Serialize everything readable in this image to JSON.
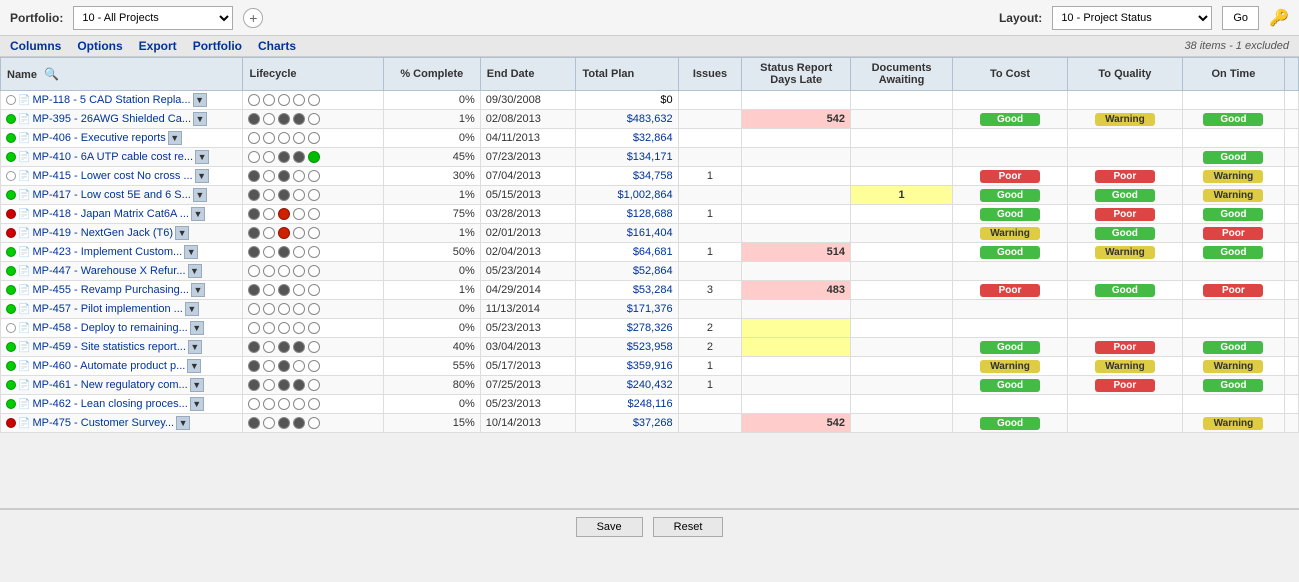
{
  "topbar": {
    "portfolio_label": "Portfolio:",
    "portfolio_value": "10 - All Projects",
    "add_btn_title": "+",
    "layout_label": "Layout:",
    "layout_value": "10 - Project Status",
    "go_label": "Go"
  },
  "menubar": {
    "items": [
      "Columns",
      "Options",
      "Export",
      "Portfolio",
      "Charts"
    ],
    "count_text": "38 items - 1 excluded"
  },
  "table": {
    "headers": [
      "Name",
      "Lifecycle",
      "% Complete",
      "End Date",
      "Total Plan",
      "Issues",
      "Status Report Days Late",
      "Documents Awaiting",
      "To Cost",
      "To Quality",
      "On Time"
    ],
    "rows": [
      {
        "dot": "empty",
        "file": true,
        "name": "MP-118 - 5 CAD Station Repla...",
        "has_dd": true,
        "lifecycle": [
          0,
          0,
          0,
          0,
          0
        ],
        "pct": "0%",
        "end": "09/30/2008",
        "total": "$0",
        "total_blue": false,
        "issues": "",
        "days_late": "",
        "days_late_style": "",
        "docs": "",
        "to_cost": "",
        "to_quality": "",
        "on_time": ""
      },
      {
        "dot": "green",
        "file": true,
        "name": "MP-395 - 26AWG Shielded Ca...",
        "has_dd": true,
        "lifecycle": [
          2,
          0,
          2,
          2,
          0
        ],
        "pct": "1%",
        "end": "02/08/2013",
        "total": "$483,632",
        "total_blue": true,
        "issues": "",
        "days_late": "542",
        "days_late_style": "red",
        "docs": "",
        "to_cost": "Good",
        "to_quality": "Warning",
        "on_time": "Good"
      },
      {
        "dot": "green",
        "file": true,
        "name": "MP-406 - Executive reports",
        "has_dd": true,
        "lifecycle": [
          0,
          0,
          0,
          0,
          0
        ],
        "pct": "0%",
        "end": "04/11/2013",
        "total": "$32,864",
        "total_blue": true,
        "issues": "",
        "days_late": "",
        "days_late_style": "",
        "docs": "",
        "to_cost": "",
        "to_quality": "",
        "on_time": ""
      },
      {
        "dot": "green",
        "file": true,
        "name": "MP-410 - 6A UTP cable cost re...",
        "has_dd": true,
        "lifecycle": [
          0,
          0,
          2,
          2,
          1
        ],
        "pct": "45%",
        "end": "07/23/2013",
        "total": "$134,171",
        "total_blue": true,
        "issues": "",
        "days_late": "",
        "days_late_style": "",
        "docs": "",
        "to_cost": "",
        "to_quality": "",
        "on_time": "Good"
      },
      {
        "dot": "empty",
        "file": true,
        "name": "MP-415 - Lower cost No cross ...",
        "has_dd": true,
        "lifecycle": [
          2,
          0,
          2,
          0,
          0
        ],
        "pct": "30%",
        "end": "07/04/2013",
        "total": "$34,758",
        "total_blue": true,
        "issues": "1",
        "days_late": "",
        "days_late_style": "",
        "docs": "",
        "to_cost": "Poor",
        "to_quality": "Poor",
        "on_time": "Warning"
      },
      {
        "dot": "green",
        "file": true,
        "name": "MP-417 - Low cost 5E and 6 S...",
        "has_dd": true,
        "lifecycle": [
          2,
          0,
          2,
          0,
          0
        ],
        "pct": "1%",
        "end": "05/15/2013",
        "total": "$1,002,864",
        "total_blue": true,
        "issues": "",
        "days_late": "",
        "days_late_style": "",
        "docs": "1",
        "to_cost": "Good",
        "to_quality": "Good",
        "on_time": "Warning"
      },
      {
        "dot": "red",
        "file": true,
        "name": "MP-418 - Japan Matrix Cat6A ...",
        "has_dd": true,
        "lifecycle": [
          2,
          0,
          3,
          0,
          0
        ],
        "pct": "75%",
        "end": "03/28/2013",
        "total": "$128,688",
        "total_blue": true,
        "issues": "1",
        "days_late": "",
        "days_late_style": "",
        "docs": "",
        "to_cost": "Good",
        "to_quality": "Poor",
        "on_time": "Good"
      },
      {
        "dot": "red",
        "file": true,
        "name": "MP-419 - NextGen Jack (T6)",
        "has_dd": true,
        "lifecycle": [
          2,
          0,
          3,
          0,
          0
        ],
        "pct": "1%",
        "end": "02/01/2013",
        "total": "$161,404",
        "total_blue": true,
        "issues": "",
        "days_late": "",
        "days_late_style": "",
        "docs": "",
        "to_cost": "Warning",
        "to_quality": "Good",
        "on_time": "Poor"
      },
      {
        "dot": "green",
        "file": true,
        "name": "MP-423 - Implement Custom...",
        "has_dd": true,
        "lifecycle": [
          2,
          0,
          2,
          0,
          0
        ],
        "pct": "50%",
        "end": "02/04/2013",
        "total": "$64,681",
        "total_blue": true,
        "issues": "1",
        "days_late": "514",
        "days_late_style": "red",
        "docs": "",
        "to_cost": "Good",
        "to_quality": "Warning",
        "on_time": "Good"
      },
      {
        "dot": "green",
        "file": true,
        "name": "MP-447 - Warehouse X Refur...",
        "has_dd": true,
        "lifecycle": [
          0,
          0,
          0,
          0,
          0
        ],
        "pct": "0%",
        "end": "05/23/2014",
        "total": "$52,864",
        "total_blue": true,
        "issues": "",
        "days_late": "",
        "days_late_style": "",
        "docs": "",
        "to_cost": "",
        "to_quality": "",
        "on_time": ""
      },
      {
        "dot": "green",
        "file": true,
        "name": "MP-455 - Revamp Purchasing...",
        "has_dd": true,
        "lifecycle": [
          2,
          0,
          2,
          0,
          0
        ],
        "pct": "1%",
        "end": "04/29/2014",
        "total": "$53,284",
        "total_blue": true,
        "issues": "3",
        "days_late": "483",
        "days_late_style": "red",
        "docs": "",
        "to_cost": "Poor",
        "to_quality": "Good",
        "on_time": "Poor"
      },
      {
        "dot": "green",
        "file": true,
        "name": "MP-457 - Pilot implemention ...",
        "has_dd": true,
        "lifecycle": [
          0,
          0,
          0,
          0,
          0
        ],
        "pct": "0%",
        "end": "11/13/2014",
        "total": "$171,376",
        "total_blue": true,
        "issues": "",
        "days_late": "",
        "days_late_style": "",
        "docs": "",
        "to_cost": "",
        "to_quality": "",
        "on_time": ""
      },
      {
        "dot": "empty",
        "file": true,
        "name": "MP-458 - Deploy to remaining...",
        "has_dd": true,
        "lifecycle": [
          0,
          0,
          0,
          0,
          0
        ],
        "pct": "0%",
        "end": "05/23/2013",
        "total": "$278,326",
        "total_blue": true,
        "issues": "2",
        "days_late": "",
        "days_late_style": "yellow",
        "docs": "",
        "to_cost": "",
        "to_quality": "",
        "on_time": ""
      },
      {
        "dot": "green",
        "file": true,
        "name": "MP-459 - Site statistics report...",
        "has_dd": true,
        "lifecycle": [
          2,
          0,
          2,
          2,
          0
        ],
        "pct": "40%",
        "end": "03/04/2013",
        "total": "$523,958",
        "total_blue": true,
        "issues": "2",
        "days_late": "",
        "days_late_style": "yellow",
        "docs": "",
        "to_cost": "Good",
        "to_quality": "Poor",
        "on_time": "Good"
      },
      {
        "dot": "green",
        "file": true,
        "name": "MP-460 - Automate product p...",
        "has_dd": true,
        "lifecycle": [
          2,
          0,
          2,
          0,
          0
        ],
        "pct": "55%",
        "end": "05/17/2013",
        "total": "$359,916",
        "total_blue": true,
        "issues": "1",
        "days_late": "",
        "days_late_style": "",
        "docs": "",
        "to_cost": "Warning",
        "to_quality": "Warning",
        "on_time": "Warning"
      },
      {
        "dot": "green",
        "file": true,
        "name": "MP-461 - New regulatory com...",
        "has_dd": true,
        "lifecycle": [
          2,
          0,
          2,
          2,
          0
        ],
        "pct": "80%",
        "end": "07/25/2013",
        "total": "$240,432",
        "total_blue": true,
        "issues": "1",
        "days_late": "",
        "days_late_style": "",
        "docs": "",
        "to_cost": "Good",
        "to_quality": "Poor",
        "on_time": "Good"
      },
      {
        "dot": "green",
        "file": true,
        "name": "MP-462 - Lean closing proces...",
        "has_dd": true,
        "lifecycle": [
          0,
          0,
          0,
          0,
          0
        ],
        "pct": "0%",
        "end": "05/23/2013",
        "total": "$248,116",
        "total_blue": true,
        "issues": "",
        "days_late": "",
        "days_late_style": "",
        "docs": "",
        "to_cost": "",
        "to_quality": "",
        "on_time": ""
      },
      {
        "dot": "red",
        "file": true,
        "name": "MP-475 - Customer Survey...",
        "has_dd": true,
        "lifecycle": [
          2,
          0,
          2,
          2,
          0
        ],
        "pct": "15%",
        "end": "10/14/2013",
        "total": "$37,268",
        "total_blue": true,
        "issues": "",
        "days_late": "542",
        "days_late_style": "red",
        "docs": "",
        "to_cost": "Good",
        "to_quality": "",
        "on_time": "Warning"
      }
    ]
  },
  "bottom": {
    "save_label": "Save",
    "reset_label": "Reset"
  }
}
